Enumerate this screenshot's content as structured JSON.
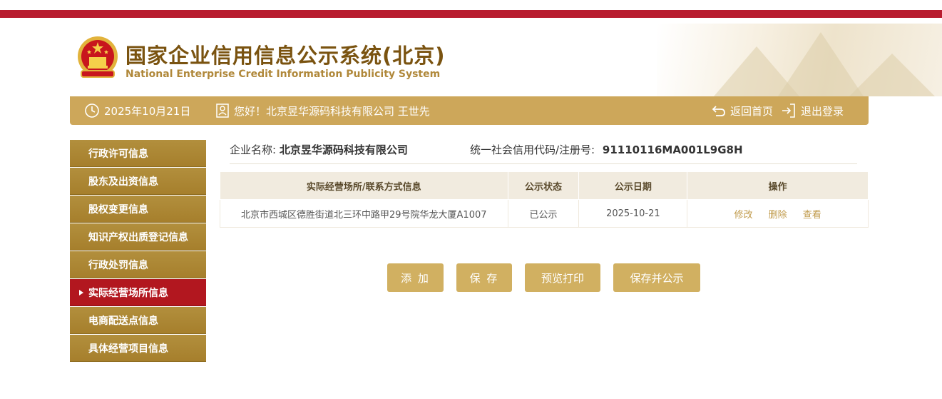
{
  "header": {
    "title_cn": "国家企业信用信息公示系统(北京)",
    "title_en": "National Enterprise Credit Information Publicity System"
  },
  "info_bar": {
    "date": "2025年10月21日",
    "greeting": "您好！北京昱华源码科技有限公司 王世先",
    "home_label": "返回首页",
    "logout_label": "退出登录"
  },
  "sidebar": {
    "items": [
      {
        "label": "行政许可信息"
      },
      {
        "label": "股东及出资信息"
      },
      {
        "label": "股权变更信息"
      },
      {
        "label": "知识产权出质登记信息"
      },
      {
        "label": "行政处罚信息"
      },
      {
        "label": "实际经营场所信息",
        "active": true
      },
      {
        "label": "电商配送点信息"
      },
      {
        "label": "具体经营项目信息"
      }
    ]
  },
  "enterprise": {
    "name_label": "企业名称:",
    "name": "北京昱华源码科技有限公司",
    "code_label": "统一社会信用代码/注册号:",
    "code": "91110116MA001L9G8H"
  },
  "table": {
    "headers": [
      "实际经营场所/联系方式信息",
      "公示状态",
      "公示日期",
      "操作"
    ],
    "rows": [
      {
        "address": "北京市西城区德胜街道北三环中路甲29号院华龙大厦A1007",
        "status": "已公示",
        "date": "2025-10-21",
        "actions": [
          "修改",
          "删除",
          "查看"
        ]
      }
    ]
  },
  "buttons": {
    "add": "添 加",
    "save": "保 存",
    "preview": "预览打印",
    "save_publish": "保存并公示"
  },
  "colors": {
    "top_bar": "#b81c2f",
    "gold_bar": "#cda75a",
    "sidebar_gold": "#a67f2c",
    "sidebar_active": "#b2171f",
    "button": "#d1b061"
  }
}
